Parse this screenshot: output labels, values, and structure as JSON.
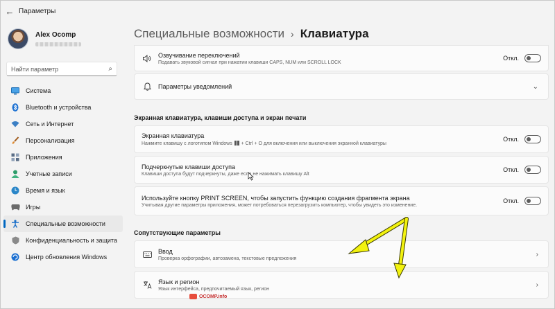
{
  "window": {
    "title": "Параметры"
  },
  "profile": {
    "name": "Alex Ocomp"
  },
  "search": {
    "placeholder": "Найти параметр"
  },
  "sidebar": {
    "items": [
      {
        "label": "Система",
        "icon": "monitor-icon",
        "color": "#2a7fd4"
      },
      {
        "label": "Bluetooth и устройства",
        "icon": "bluetooth-icon",
        "color": "#1a6fd1"
      },
      {
        "label": "Сеть и Интернет",
        "icon": "wifi-icon",
        "color": "#3b7fc4"
      },
      {
        "label": "Персонализация",
        "icon": "brush-icon",
        "color": "#d07a2c"
      },
      {
        "label": "Приложения",
        "icon": "apps-icon",
        "color": "#5a6d86"
      },
      {
        "label": "Учетные записи",
        "icon": "person-icon",
        "color": "#2e9c6a"
      },
      {
        "label": "Время и язык",
        "icon": "globe-clock-icon",
        "color": "#2a86c8"
      },
      {
        "label": "Игры",
        "icon": "gamepad-icon",
        "color": "#6b6b6b"
      },
      {
        "label": "Специальные возможности",
        "icon": "accessibility-icon",
        "color": "#1b6fc9",
        "active": true
      },
      {
        "label": "Конфиденциальность и защита",
        "icon": "shield-icon",
        "color": "#707070"
      },
      {
        "label": "Центр обновления Windows",
        "icon": "update-icon",
        "color": "#1a6fd1"
      }
    ]
  },
  "breadcrumb": {
    "parent": "Специальные возможности",
    "separator": "›",
    "current": "Клавиатура"
  },
  "cards": {
    "sound_toggle": {
      "title": "Озвучивание переключений",
      "desc": "Подавать звуковой сигнал при нажатии клавиши CAPS, NUM или SCROLL LOCK",
      "state": "Откл."
    },
    "notifications": {
      "title": "Параметры уведомлений"
    },
    "on_screen_keyboard": {
      "title": "Экранная клавиатура",
      "desc_before": "Нажмите клавишу с логотипом Windows",
      "desc_after": "+ Ctrl + O для включения или выключения экранной клавиатуры",
      "state": "Откл."
    },
    "underline_keys": {
      "title": "Подчеркнутые клавиши доступа",
      "desc": "Клавиши доступа будут подчеркнуты, даже если не нажимать клавишу Alt",
      "state": "Откл."
    },
    "print_screen": {
      "title": "Используйте кнопку PRINT SCREEN, чтобы запустить функцию создания фрагмента экрана",
      "desc": "Учитывая другие параметры приложения, может потребоваться перезагрузить компьютер, чтобы увидеть это изменение.",
      "state": "Откл."
    },
    "input": {
      "title": "Ввод",
      "desc": "Проверка орфографии, автозамена, текстовые предложения"
    },
    "language": {
      "title": "Язык и регион",
      "desc": "Язык интерфейса, предпочитаемый язык, регион"
    }
  },
  "sections": {
    "osk_title": "Экранная клавиатура, клавиши доступа и экран печати",
    "related_title": "Сопутствующие параметры"
  },
  "watermark": {
    "text": "OCOMP.info"
  },
  "colors": {
    "accent": "#0067c0",
    "annotation_arrow": "#f2f20f"
  }
}
